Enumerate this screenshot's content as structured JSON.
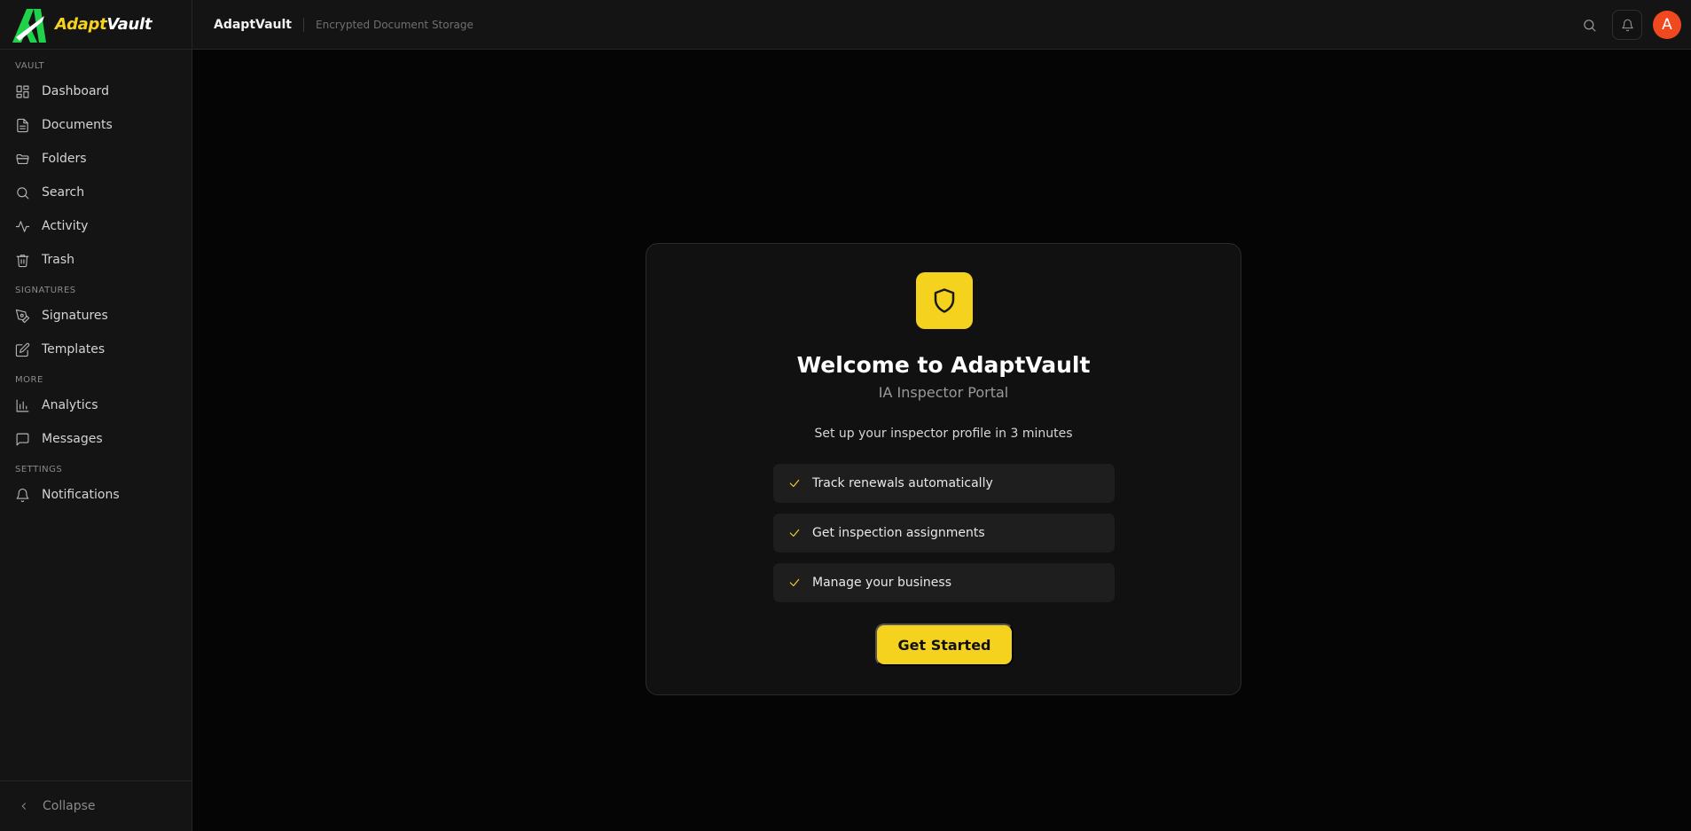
{
  "brand": {
    "part1": "Adapt",
    "part2": "Vault"
  },
  "sidebar": {
    "sections": [
      {
        "label": "VAULT",
        "items": [
          {
            "label": "Dashboard",
            "icon": "dashboard-icon"
          },
          {
            "label": "Documents",
            "icon": "document-icon"
          },
          {
            "label": "Folders",
            "icon": "folder-icon"
          },
          {
            "label": "Search",
            "icon": "search-icon"
          },
          {
            "label": "Activity",
            "icon": "activity-icon"
          },
          {
            "label": "Trash",
            "icon": "trash-icon"
          }
        ]
      },
      {
        "label": "SIGNATURES",
        "items": [
          {
            "label": "Signatures",
            "icon": "pen-icon"
          },
          {
            "label": "Templates",
            "icon": "edit-icon"
          }
        ]
      },
      {
        "label": "MORE",
        "items": [
          {
            "label": "Analytics",
            "icon": "bar-chart-icon"
          },
          {
            "label": "Messages",
            "icon": "message-icon"
          }
        ]
      },
      {
        "label": "SETTINGS",
        "items": [
          {
            "label": "Notifications",
            "icon": "bell-icon"
          }
        ]
      }
    ],
    "collapse_label": "Collapse"
  },
  "topbar": {
    "title": "AdaptVault",
    "subtitle": "Encrypted Document Storage",
    "avatar_initial": "A"
  },
  "colors": {
    "accent": "#f5d21e",
    "avatar": "#f1491f",
    "background": "#050505",
    "surface": "#141414"
  },
  "welcome": {
    "title": "Welcome to AdaptVault",
    "subtitle": "IA Inspector Portal",
    "description": "Set up your inspector profile in 3 minutes",
    "features": [
      "Track renewals automatically",
      "Get inspection assignments",
      "Manage your business"
    ],
    "cta_label": "Get Started"
  }
}
